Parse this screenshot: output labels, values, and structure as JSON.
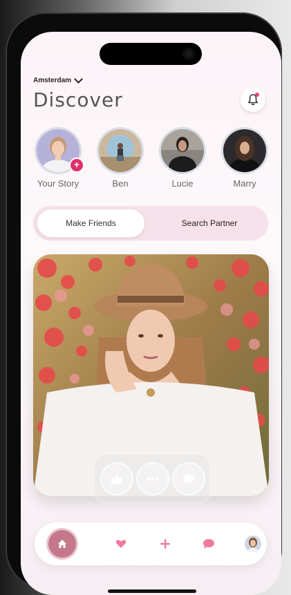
{
  "header": {
    "location": "Amsterdam",
    "title": "Discover"
  },
  "stories": [
    {
      "name": "Your Story",
      "is_own": true
    },
    {
      "name": "Ben"
    },
    {
      "name": "Lucie"
    },
    {
      "name": "Marry"
    }
  ],
  "tabs": [
    {
      "label": "Make Friends",
      "active": true
    },
    {
      "label": "Search Partner",
      "active": false
    }
  ],
  "card_actions": [
    "like-icon",
    "more-icon",
    "chat-icon"
  ],
  "bottom_nav": [
    "home-icon",
    "heart-icon",
    "plus-icon",
    "message-icon",
    "profile-avatar"
  ],
  "colors": {
    "accent": "#e0306a",
    "tab_track": "#f7e1ea",
    "home_button": "#c5788b",
    "nav_icon": "#f07a9a"
  }
}
